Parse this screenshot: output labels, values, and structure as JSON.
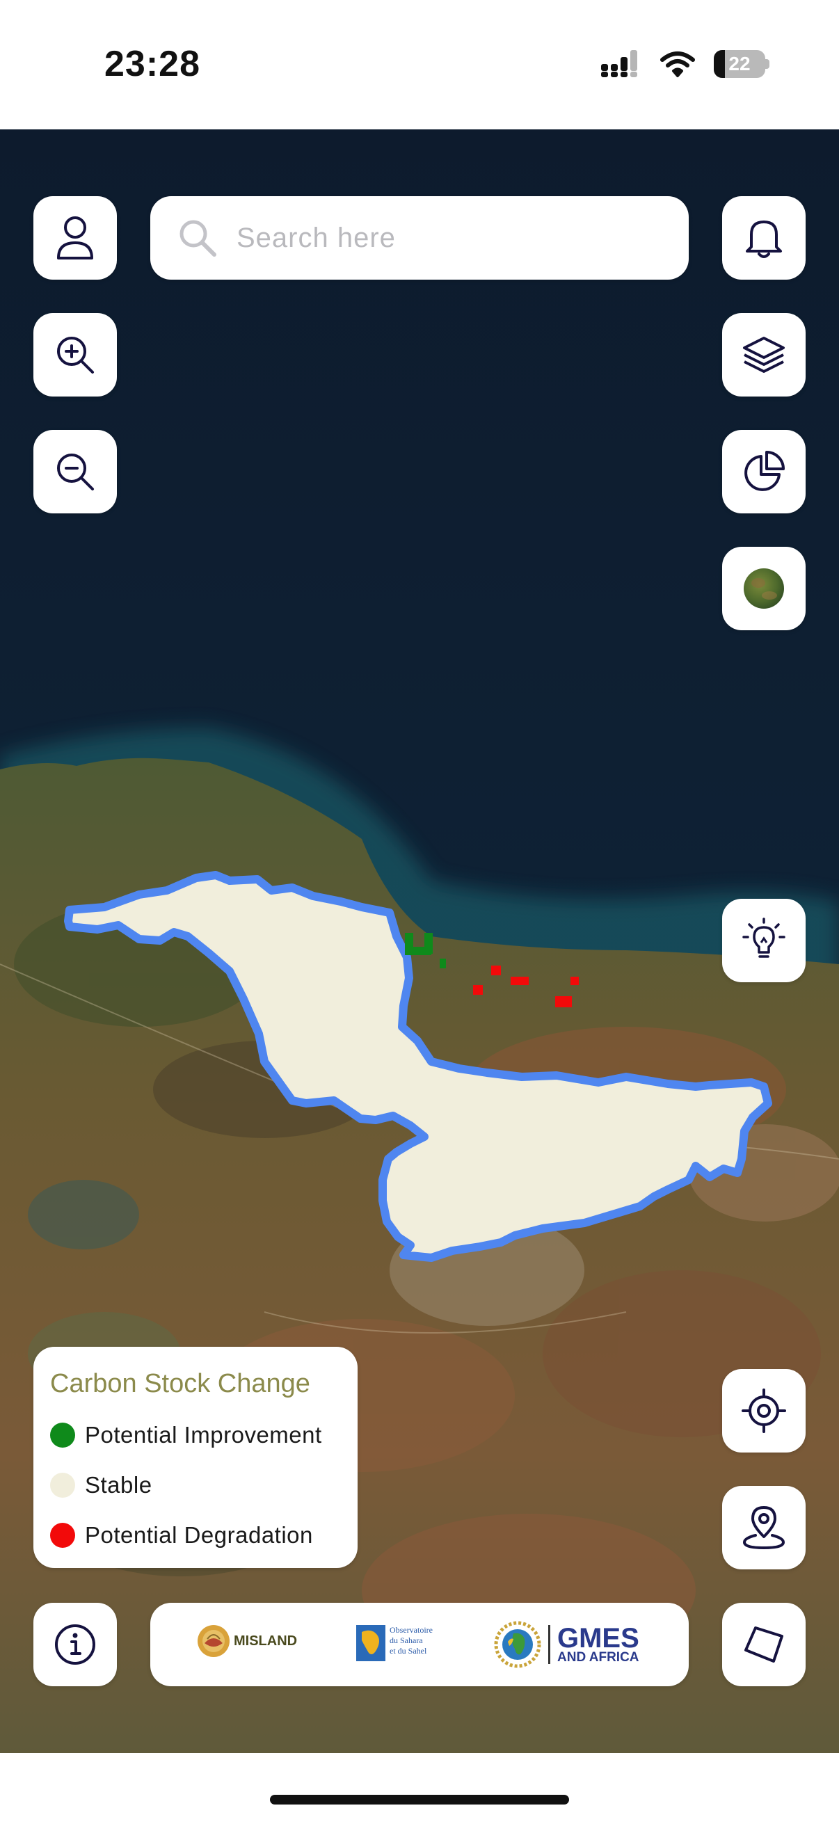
{
  "status_bar": {
    "time": "23:28",
    "battery_level": "22",
    "battery_fraction": 0.22,
    "icons": [
      "cellular-signal-icon",
      "wifi-icon",
      "battery-icon"
    ]
  },
  "search": {
    "placeholder": "Search here"
  },
  "map_controls": {
    "left": [
      "user-profile-button",
      "zoom-in-button",
      "zoom-out-button",
      "info-button"
    ],
    "right": [
      "notifications-button",
      "layers-button",
      "statistics-button",
      "basemap-button",
      "insights-button",
      "locate-me-button",
      "pin-location-button",
      "draw-area-button"
    ]
  },
  "legend": {
    "title": "Carbon Stock Change",
    "items": [
      {
        "label": "Potential Improvement",
        "color": "#0f8a1b"
      },
      {
        "label": "Stable",
        "color": "#f1eedc"
      },
      {
        "label": "Potential Degradation",
        "color": "#f20a0a"
      }
    ]
  },
  "logos": {
    "misland": "MISLAND",
    "oss_lines": [
      "Observatoire",
      "du Sahara",
      "et du Sahel"
    ],
    "gmes_main": "GMES",
    "gmes_sub": "AND AFRICA"
  },
  "colors": {
    "region_outline": "#4f86f0",
    "region_fill": "#f1eedc",
    "sea": "#0e1c2e",
    "icon_stroke": "#15123f"
  }
}
